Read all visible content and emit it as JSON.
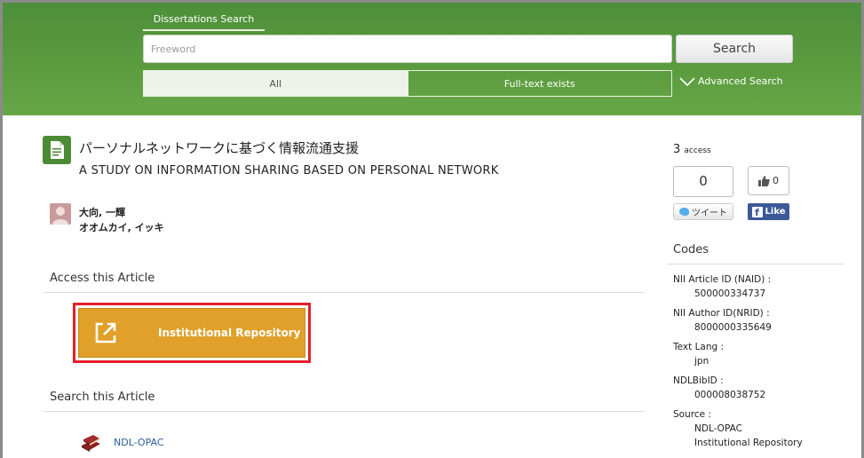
{
  "header": {
    "tab_label": "Dissertations Search",
    "search_placeholder": "Freeword",
    "search_value": "",
    "search_button": "Search",
    "filters": [
      {
        "label": "All",
        "active": true
      },
      {
        "label": "Full-text exists",
        "active": false
      }
    ],
    "advanced_search": "Advanced Search"
  },
  "article": {
    "title_ja": "パーソナルネットワークに基づく情報流通支援",
    "title_en": "A STUDY ON INFORMATION SHARING BASED ON PERSONAL NETWORK",
    "author_name": "大向, 一輝",
    "author_kana": "オオムカイ, イッキ",
    "access_section": "Access this Article",
    "repository_button": "Institutional Repository",
    "search_section": "Search this Article",
    "ndl_link": "NDL-OPAC"
  },
  "sidebar": {
    "access_count": "3",
    "access_unit": "access",
    "tweet_count": "0",
    "tweet_label": "ツイート",
    "like_count": "0",
    "like_label": "Like",
    "codes_title": "Codes",
    "codes": [
      {
        "label": "NII Article ID (NAID) :",
        "values": [
          "500000334737"
        ]
      },
      {
        "label": "NII Author ID(NRID) :",
        "values": [
          "8000000335649"
        ]
      },
      {
        "label": "Text Lang :",
        "values": [
          "jpn"
        ]
      },
      {
        "label": "NDLBibID :",
        "values": [
          "000008038752"
        ]
      },
      {
        "label": "Source :",
        "values": [
          "NDL-OPAC",
          "Institutional Repository"
        ]
      }
    ]
  },
  "colors": {
    "header_green": "#5c9c40",
    "repository_orange": "#e0a02a",
    "highlight_red": "#e3202a",
    "link_blue": "#2a5e9a",
    "facebook_blue": "#3b5998",
    "twitter_blue": "#55acee"
  }
}
